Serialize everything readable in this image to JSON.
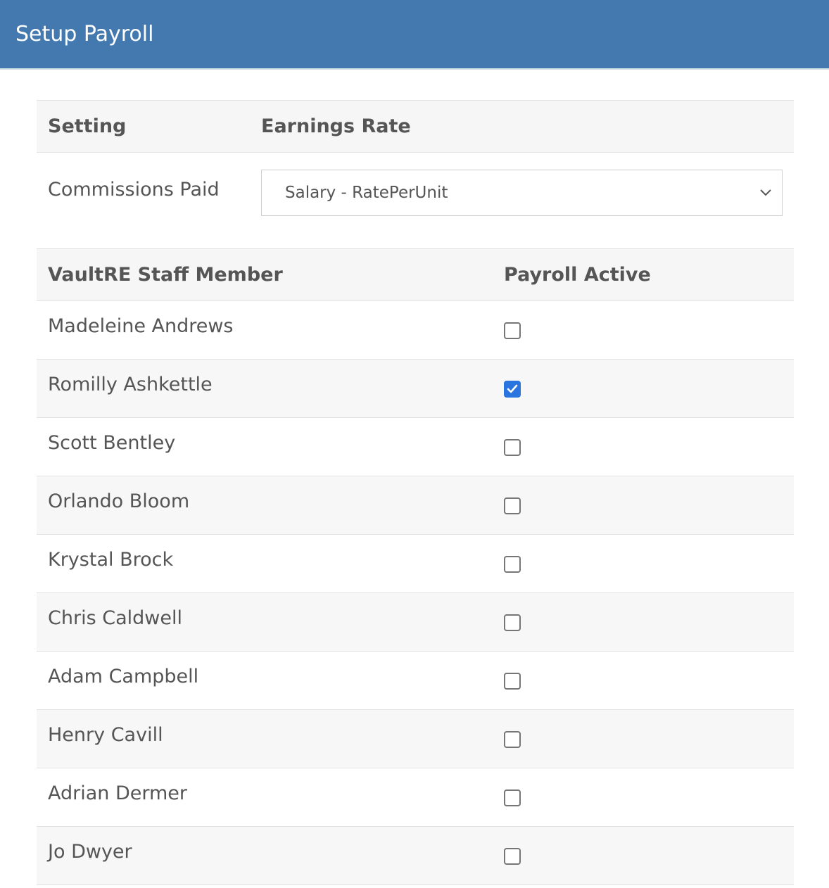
{
  "header": {
    "title": "Setup Payroll"
  },
  "settings": {
    "col_setting": "Setting",
    "col_earnings_rate": "Earnings Rate",
    "rows": [
      {
        "label": "Commissions Paid",
        "value": "Salary - RatePerUnit"
      }
    ]
  },
  "staff": {
    "col_member": "VaultRE Staff Member",
    "col_active": "Payroll Active",
    "members": [
      {
        "name": "Madeleine Andrews",
        "active": false
      },
      {
        "name": "Romilly Ashkettle",
        "active": true
      },
      {
        "name": "Scott Bentley",
        "active": false
      },
      {
        "name": "Orlando Bloom",
        "active": false
      },
      {
        "name": "Krystal Brock",
        "active": false
      },
      {
        "name": "Chris Caldwell",
        "active": false
      },
      {
        "name": "Adam Campbell",
        "active": false
      },
      {
        "name": "Henry Cavill",
        "active": false
      },
      {
        "name": "Adrian Dermer",
        "active": false
      },
      {
        "name": "Jo Dwyer",
        "active": false
      }
    ]
  },
  "colors": {
    "header_bg": "#4479b0",
    "checkbox_checked": "#2a74df"
  }
}
